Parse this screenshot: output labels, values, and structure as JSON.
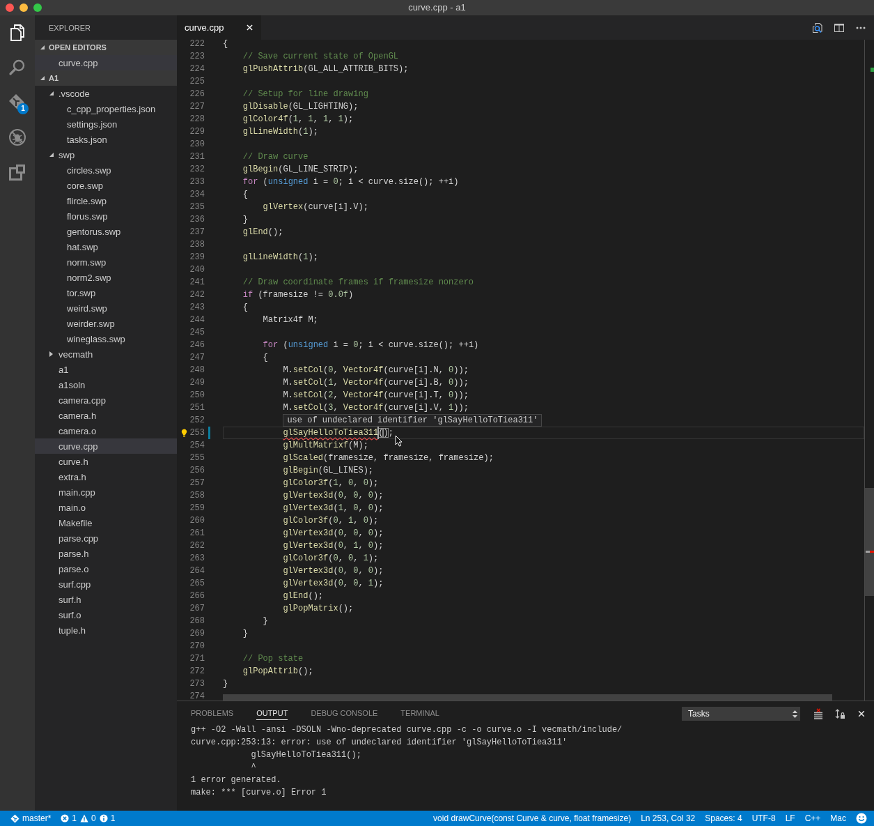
{
  "window": {
    "title": "curve.cpp - a1"
  },
  "activity_bar": {
    "items": [
      {
        "kind": "explorer",
        "selected": true
      },
      {
        "kind": "search",
        "selected": false
      },
      {
        "kind": "source_control",
        "selected": false,
        "badge": "1"
      },
      {
        "kind": "debug",
        "selected": false
      },
      {
        "kind": "extensions",
        "selected": false
      }
    ]
  },
  "sidebar": {
    "title": "EXPLORER",
    "sections": [
      {
        "title": "OPEN EDITORS",
        "expanded": true,
        "items": [
          {
            "label": "curve.cpp",
            "kind": "file",
            "selected": true
          }
        ]
      },
      {
        "title": "A1",
        "expanded": true,
        "items": [
          {
            "label": ".vscode",
            "kind": "folder",
            "expanded": true,
            "selected": false,
            "children": [
              {
                "label": "c_cpp_properties.json",
                "kind": "file",
                "selected": false
              },
              {
                "label": "settings.json",
                "kind": "file",
                "selected": false
              },
              {
                "label": "tasks.json",
                "kind": "file",
                "selected": false
              }
            ]
          },
          {
            "label": "swp",
            "kind": "folder",
            "expanded": true,
            "selected": false,
            "children": [
              {
                "label": "circles.swp",
                "kind": "file",
                "selected": false
              },
              {
                "label": "core.swp",
                "kind": "file",
                "selected": false
              },
              {
                "label": "flircle.swp",
                "kind": "file",
                "selected": false
              },
              {
                "label": "florus.swp",
                "kind": "file",
                "selected": false
              },
              {
                "label": "gentorus.swp",
                "kind": "file",
                "selected": false
              },
              {
                "label": "hat.swp",
                "kind": "file",
                "selected": false
              },
              {
                "label": "norm.swp",
                "kind": "file",
                "selected": false
              },
              {
                "label": "norm2.swp",
                "kind": "file",
                "selected": false
              },
              {
                "label": "tor.swp",
                "kind": "file",
                "selected": false
              },
              {
                "label": "weird.swp",
                "kind": "file",
                "selected": false
              },
              {
                "label": "weirder.swp",
                "kind": "file",
                "selected": false
              },
              {
                "label": "wineglass.swp",
                "kind": "file",
                "selected": false
              }
            ]
          },
          {
            "label": "vecmath",
            "kind": "folder",
            "expanded": false,
            "selected": false
          },
          {
            "label": "a1",
            "kind": "file",
            "selected": false
          },
          {
            "label": "a1soln",
            "kind": "file",
            "selected": false
          },
          {
            "label": "camera.cpp",
            "kind": "file",
            "selected": false
          },
          {
            "label": "camera.h",
            "kind": "file",
            "selected": false
          },
          {
            "label": "camera.o",
            "kind": "file",
            "selected": false
          },
          {
            "label": "curve.cpp",
            "kind": "file",
            "selected": true
          },
          {
            "label": "curve.h",
            "kind": "file",
            "selected": false
          },
          {
            "label": "extra.h",
            "kind": "file",
            "selected": false
          },
          {
            "label": "main.cpp",
            "kind": "file",
            "selected": false
          },
          {
            "label": "main.o",
            "kind": "file",
            "selected": false
          },
          {
            "label": "Makefile",
            "kind": "file",
            "selected": false
          },
          {
            "label": "parse.cpp",
            "kind": "file",
            "selected": false
          },
          {
            "label": "parse.h",
            "kind": "file",
            "selected": false
          },
          {
            "label": "parse.o",
            "kind": "file",
            "selected": false
          },
          {
            "label": "surf.cpp",
            "kind": "file",
            "selected": false
          },
          {
            "label": "surf.h",
            "kind": "file",
            "selected": false
          },
          {
            "label": "surf.o",
            "kind": "file",
            "selected": false
          },
          {
            "label": "tuple.h",
            "kind": "file",
            "selected": false
          }
        ]
      }
    ]
  },
  "editor": {
    "tabs": [
      {
        "label": "curve.cpp",
        "selected": true
      }
    ],
    "lines": [
      {
        "number": "222",
        "tokens": [
          {
            "kind": "plain",
            "text": "{"
          }
        ]
      },
      {
        "number": "223",
        "tokens": [
          {
            "kind": "comment",
            "text": "    // Save current state of OpenGL"
          }
        ]
      },
      {
        "number": "224",
        "tokens": [
          {
            "kind": "function",
            "text": "    glPushAttrib"
          },
          {
            "kind": "plain",
            "text": "(GL_ALL_ATTRIB_BITS);"
          }
        ]
      },
      {
        "number": "225"
      },
      {
        "number": "226",
        "tokens": [
          {
            "kind": "comment",
            "text": "    // Setup for line drawing"
          }
        ]
      },
      {
        "number": "227",
        "tokens": [
          {
            "kind": "function",
            "text": "    glDisable"
          },
          {
            "kind": "plain",
            "text": "(GL_LIGHTING);"
          }
        ]
      },
      {
        "number": "228",
        "tokens": [
          {
            "kind": "function",
            "text": "    glColor4f"
          },
          {
            "kind": "plain",
            "text": "("
          },
          {
            "kind": "number",
            "text": "1"
          },
          {
            "kind": "plain",
            "text": ", "
          },
          {
            "kind": "number",
            "text": "1"
          },
          {
            "kind": "plain",
            "text": ", "
          },
          {
            "kind": "number",
            "text": "1"
          },
          {
            "kind": "plain",
            "text": ", "
          },
          {
            "kind": "number",
            "text": "1"
          },
          {
            "kind": "plain",
            "text": ");"
          }
        ]
      },
      {
        "number": "229",
        "tokens": [
          {
            "kind": "function",
            "text": "    glLineWidth"
          },
          {
            "kind": "plain",
            "text": "("
          },
          {
            "kind": "number",
            "text": "1"
          },
          {
            "kind": "plain",
            "text": ");"
          }
        ]
      },
      {
        "number": "230"
      },
      {
        "number": "231",
        "tokens": [
          {
            "kind": "comment",
            "text": "    // Draw curve"
          }
        ]
      },
      {
        "number": "232",
        "tokens": [
          {
            "kind": "function",
            "text": "    glBegin"
          },
          {
            "kind": "plain",
            "text": "(GL_LINE_STRIP);"
          }
        ]
      },
      {
        "number": "233",
        "tokens": [
          {
            "kind": "keyword",
            "text": "    for"
          },
          {
            "kind": "plain",
            "text": " ("
          },
          {
            "kind": "storage",
            "text": "unsigned"
          },
          {
            "kind": "plain",
            "text": " i = "
          },
          {
            "kind": "number",
            "text": "0"
          },
          {
            "kind": "plain",
            "text": "; i < curve.size(); ++i)"
          }
        ]
      },
      {
        "number": "234",
        "tokens": [
          {
            "kind": "plain",
            "text": "    {"
          }
        ]
      },
      {
        "number": "235",
        "tokens": [
          {
            "kind": "function",
            "text": "        glVertex"
          },
          {
            "kind": "plain",
            "text": "(curve[i].V);"
          }
        ]
      },
      {
        "number": "236",
        "tokens": [
          {
            "kind": "plain",
            "text": "    }"
          }
        ]
      },
      {
        "number": "237",
        "tokens": [
          {
            "kind": "function",
            "text": "    glEnd"
          },
          {
            "kind": "plain",
            "text": "();"
          }
        ]
      },
      {
        "number": "238"
      },
      {
        "number": "239",
        "tokens": [
          {
            "kind": "function",
            "text": "    glLineWidth"
          },
          {
            "kind": "plain",
            "text": "("
          },
          {
            "kind": "number",
            "text": "1"
          },
          {
            "kind": "plain",
            "text": ");"
          }
        ]
      },
      {
        "number": "240"
      },
      {
        "number": "241",
        "tokens": [
          {
            "kind": "comment",
            "text": "    // Draw coordinate frames if framesize nonzero"
          }
        ]
      },
      {
        "number": "242",
        "tokens": [
          {
            "kind": "keyword",
            "text": "    if"
          },
          {
            "kind": "plain",
            "text": " (framesize != "
          },
          {
            "kind": "number",
            "text": "0.0f"
          },
          {
            "kind": "plain",
            "text": ")"
          }
        ]
      },
      {
        "number": "243",
        "tokens": [
          {
            "kind": "plain",
            "text": "    {"
          }
        ]
      },
      {
        "number": "244",
        "tokens": [
          {
            "kind": "plain",
            "text": "        Matrix4f M;"
          }
        ]
      },
      {
        "number": "245"
      },
      {
        "number": "246",
        "tokens": [
          {
            "kind": "keyword",
            "text": "        for"
          },
          {
            "kind": "plain",
            "text": " ("
          },
          {
            "kind": "storage",
            "text": "unsigned"
          },
          {
            "kind": "plain",
            "text": " i = "
          },
          {
            "kind": "number",
            "text": "0"
          },
          {
            "kind": "plain",
            "text": "; i < curve.size(); ++i)"
          }
        ]
      },
      {
        "number": "247",
        "tokens": [
          {
            "kind": "plain",
            "text": "        {"
          }
        ]
      },
      {
        "number": "248",
        "tokens": [
          {
            "kind": "plain",
            "text": "            M."
          },
          {
            "kind": "function",
            "text": "setCol"
          },
          {
            "kind": "plain",
            "text": "("
          },
          {
            "kind": "number",
            "text": "0"
          },
          {
            "kind": "plain",
            "text": ", "
          },
          {
            "kind": "function",
            "text": "Vector4f"
          },
          {
            "kind": "plain",
            "text": "(curve[i].N, "
          },
          {
            "kind": "number",
            "text": "0"
          },
          {
            "kind": "plain",
            "text": "));"
          }
        ]
      },
      {
        "number": "249",
        "tokens": [
          {
            "kind": "plain",
            "text": "            M."
          },
          {
            "kind": "function",
            "text": "setCol"
          },
          {
            "kind": "plain",
            "text": "("
          },
          {
            "kind": "number",
            "text": "1"
          },
          {
            "kind": "plain",
            "text": ", "
          },
          {
            "kind": "function",
            "text": "Vector4f"
          },
          {
            "kind": "plain",
            "text": "(curve[i].B, "
          },
          {
            "kind": "number",
            "text": "0"
          },
          {
            "kind": "plain",
            "text": "));"
          }
        ]
      },
      {
        "number": "250",
        "tokens": [
          {
            "kind": "plain",
            "text": "            M."
          },
          {
            "kind": "function",
            "text": "setCol"
          },
          {
            "kind": "plain",
            "text": "("
          },
          {
            "kind": "number",
            "text": "2"
          },
          {
            "kind": "plain",
            "text": ", "
          },
          {
            "kind": "function",
            "text": "Vector4f"
          },
          {
            "kind": "plain",
            "text": "(curve[i].T, "
          },
          {
            "kind": "number",
            "text": "0"
          },
          {
            "kind": "plain",
            "text": "));"
          }
        ]
      },
      {
        "number": "251",
        "tokens": [
          {
            "kind": "plain",
            "text": "            M."
          },
          {
            "kind": "function",
            "text": "setCol"
          },
          {
            "kind": "plain",
            "text": "("
          },
          {
            "kind": "number",
            "text": "3"
          },
          {
            "kind": "plain",
            "text": ", "
          },
          {
            "kind": "function",
            "text": "Vector4f"
          },
          {
            "kind": "plain",
            "text": "(curve[i].V, "
          },
          {
            "kind": "number",
            "text": "1"
          },
          {
            "kind": "plain",
            "text": "));"
          }
        ]
      },
      {
        "number": "252"
      },
      {
        "number": "253",
        "current": true,
        "lightbulb": true,
        "modified": true,
        "tokens": [
          {
            "kind": "function",
            "text": "            glSayHelloToTiea311",
            "squiggle": true
          },
          {
            "kind": "bracket",
            "text": "()",
            "cursor": true
          },
          {
            "kind": "plain",
            "text": ";"
          }
        ]
      },
      {
        "number": "254",
        "tokens": [
          {
            "kind": "function",
            "text": "            glMultMatrixf"
          },
          {
            "kind": "plain",
            "text": "(M);"
          }
        ]
      },
      {
        "number": "255",
        "tokens": [
          {
            "kind": "function",
            "text": "            glScaled"
          },
          {
            "kind": "plain",
            "text": "(framesize, framesize, framesize);"
          }
        ]
      },
      {
        "number": "256",
        "tokens": [
          {
            "kind": "function",
            "text": "            glBegin"
          },
          {
            "kind": "plain",
            "text": "(GL_LINES);"
          }
        ]
      },
      {
        "number": "257",
        "tokens": [
          {
            "kind": "function",
            "text": "            glColor3f"
          },
          {
            "kind": "plain",
            "text": "("
          },
          {
            "kind": "number",
            "text": "1"
          },
          {
            "kind": "plain",
            "text": ", "
          },
          {
            "kind": "number",
            "text": "0"
          },
          {
            "kind": "plain",
            "text": ", "
          },
          {
            "kind": "number",
            "text": "0"
          },
          {
            "kind": "plain",
            "text": ");"
          }
        ]
      },
      {
        "number": "258",
        "tokens": [
          {
            "kind": "function",
            "text": "            glVertex3d"
          },
          {
            "kind": "plain",
            "text": "("
          },
          {
            "kind": "number",
            "text": "0"
          },
          {
            "kind": "plain",
            "text": ", "
          },
          {
            "kind": "number",
            "text": "0"
          },
          {
            "kind": "plain",
            "text": ", "
          },
          {
            "kind": "number",
            "text": "0"
          },
          {
            "kind": "plain",
            "text": ");"
          }
        ]
      },
      {
        "number": "259",
        "tokens": [
          {
            "kind": "function",
            "text": "            glVertex3d"
          },
          {
            "kind": "plain",
            "text": "("
          },
          {
            "kind": "number",
            "text": "1"
          },
          {
            "kind": "plain",
            "text": ", "
          },
          {
            "kind": "number",
            "text": "0"
          },
          {
            "kind": "plain",
            "text": ", "
          },
          {
            "kind": "number",
            "text": "0"
          },
          {
            "kind": "plain",
            "text": ");"
          }
        ]
      },
      {
        "number": "260",
        "tokens": [
          {
            "kind": "function",
            "text": "            glColor3f"
          },
          {
            "kind": "plain",
            "text": "("
          },
          {
            "kind": "number",
            "text": "0"
          },
          {
            "kind": "plain",
            "text": ", "
          },
          {
            "kind": "number",
            "text": "1"
          },
          {
            "kind": "plain",
            "text": ", "
          },
          {
            "kind": "number",
            "text": "0"
          },
          {
            "kind": "plain",
            "text": ");"
          }
        ]
      },
      {
        "number": "261",
        "tokens": [
          {
            "kind": "function",
            "text": "            glVertex3d"
          },
          {
            "kind": "plain",
            "text": "("
          },
          {
            "kind": "number",
            "text": "0"
          },
          {
            "kind": "plain",
            "text": ", "
          },
          {
            "kind": "number",
            "text": "0"
          },
          {
            "kind": "plain",
            "text": ", "
          },
          {
            "kind": "number",
            "text": "0"
          },
          {
            "kind": "plain",
            "text": ");"
          }
        ]
      },
      {
        "number": "262",
        "tokens": [
          {
            "kind": "function",
            "text": "            glVertex3d"
          },
          {
            "kind": "plain",
            "text": "("
          },
          {
            "kind": "number",
            "text": "0"
          },
          {
            "kind": "plain",
            "text": ", "
          },
          {
            "kind": "number",
            "text": "1"
          },
          {
            "kind": "plain",
            "text": ", "
          },
          {
            "kind": "number",
            "text": "0"
          },
          {
            "kind": "plain",
            "text": ");"
          }
        ]
      },
      {
        "number": "263",
        "tokens": [
          {
            "kind": "function",
            "text": "            glColor3f"
          },
          {
            "kind": "plain",
            "text": "("
          },
          {
            "kind": "number",
            "text": "0"
          },
          {
            "kind": "plain",
            "text": ", "
          },
          {
            "kind": "number",
            "text": "0"
          },
          {
            "kind": "plain",
            "text": ", "
          },
          {
            "kind": "number",
            "text": "1"
          },
          {
            "kind": "plain",
            "text": ");"
          }
        ]
      },
      {
        "number": "264",
        "tokens": [
          {
            "kind": "function",
            "text": "            glVertex3d"
          },
          {
            "kind": "plain",
            "text": "("
          },
          {
            "kind": "number",
            "text": "0"
          },
          {
            "kind": "plain",
            "text": ", "
          },
          {
            "kind": "number",
            "text": "0"
          },
          {
            "kind": "plain",
            "text": ", "
          },
          {
            "kind": "number",
            "text": "0"
          },
          {
            "kind": "plain",
            "text": ");"
          }
        ]
      },
      {
        "number": "265",
        "tokens": [
          {
            "kind": "function",
            "text": "            glVertex3d"
          },
          {
            "kind": "plain",
            "text": "("
          },
          {
            "kind": "number",
            "text": "0"
          },
          {
            "kind": "plain",
            "text": ", "
          },
          {
            "kind": "number",
            "text": "0"
          },
          {
            "kind": "plain",
            "text": ", "
          },
          {
            "kind": "number",
            "text": "1"
          },
          {
            "kind": "plain",
            "text": ");"
          }
        ]
      },
      {
        "number": "266",
        "tokens": [
          {
            "kind": "function",
            "text": "            glEnd"
          },
          {
            "kind": "plain",
            "text": "();"
          }
        ]
      },
      {
        "number": "267",
        "tokens": [
          {
            "kind": "function",
            "text": "            glPopMatrix"
          },
          {
            "kind": "plain",
            "text": "();"
          }
        ]
      },
      {
        "number": "268",
        "tokens": [
          {
            "kind": "plain",
            "text": "        }"
          }
        ]
      },
      {
        "number": "269",
        "tokens": [
          {
            "kind": "plain",
            "text": "    }"
          }
        ]
      },
      {
        "number": "270"
      },
      {
        "number": "271",
        "tokens": [
          {
            "kind": "comment",
            "text": "    // Pop state"
          }
        ]
      },
      {
        "number": "272",
        "tokens": [
          {
            "kind": "function",
            "text": "    glPopAttrib"
          },
          {
            "kind": "plain",
            "text": "();"
          }
        ]
      },
      {
        "number": "273",
        "tokens": [
          {
            "kind": "plain",
            "text": "}"
          }
        ]
      },
      {
        "number": "274"
      }
    ],
    "hover": {
      "text": "use of undeclared identifier 'glSayHelloToTiea311'"
    }
  },
  "panel": {
    "tabs": [
      {
        "label": "PROBLEMS",
        "selected": false
      },
      {
        "label": "OUTPUT",
        "selected": true
      },
      {
        "label": "DEBUG CONSOLE",
        "selected": false
      },
      {
        "label": "TERMINAL",
        "selected": false
      }
    ],
    "task_select": {
      "value": "Tasks"
    },
    "output": [
      "g++ -O2 -Wall -ansi -DSOLN -Wno-deprecated curve.cpp -c -o curve.o -I vecmath/include/",
      "curve.cpp:253:13: error: use of undeclared identifier 'glSayHelloToTiea311'",
      "            glSayHelloToTiea311();",
      "            ^",
      "1 error generated.",
      "make: *** [curve.o] Error 1"
    ]
  },
  "status_bar": {
    "branch": "master*",
    "errors": "1",
    "warnings": "0",
    "infos": "1",
    "function": "void drawCurve(const Curve & curve, float framesize)",
    "cursor_position": "Ln 253, Col 32",
    "indentation": "Spaces: 4",
    "encoding": "UTF-8",
    "line_ending": "LF",
    "language": "C++",
    "keymap": "Mac"
  }
}
